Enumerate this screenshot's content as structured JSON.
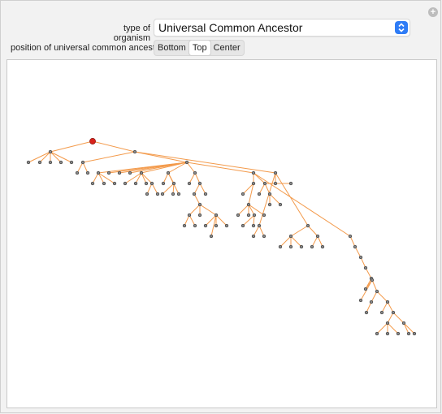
{
  "controls": {
    "organism_label": "type of organism",
    "organism_value": "Universal Common Ancestor",
    "position_label": "position of universal common ancestor",
    "position_options": [
      "Bottom",
      "Top",
      "Center"
    ],
    "position_selected": "Top"
  },
  "colors": {
    "edge": "#f39a4b",
    "node_fill": "#8a8a8a",
    "node_stroke": "#3a3a3a",
    "root_fill": "#d8221b",
    "root_stroke": "#8a1410",
    "accent": "#2f7cf6"
  },
  "icons": {
    "expand": "plus-circle-icon",
    "dropdown": "chevron-updown-icon"
  },
  "tree": {
    "root": "root",
    "edges": [
      [
        "root",
        "a1"
      ],
      [
        "root",
        "a2"
      ],
      [
        "a1",
        "b1"
      ],
      [
        "a1",
        "b2"
      ],
      [
        "a1",
        "b3"
      ],
      [
        "a1",
        "b4"
      ],
      [
        "a1",
        "b5"
      ],
      [
        "a2",
        "c1"
      ],
      [
        "a2",
        "c2"
      ],
      [
        "a2",
        "c3"
      ],
      [
        "c1",
        "d1"
      ],
      [
        "c1",
        "d2"
      ],
      [
        "c2",
        "e1"
      ],
      [
        "c2",
        "e2"
      ],
      [
        "c2",
        "e3"
      ],
      [
        "c2",
        "e4"
      ],
      [
        "c2",
        "e5"
      ],
      [
        "c2",
        "e6"
      ],
      [
        "c2",
        "e7"
      ],
      [
        "c2",
        "e8"
      ],
      [
        "e1",
        "f1"
      ],
      [
        "e1",
        "f2"
      ],
      [
        "e1",
        "f3"
      ],
      [
        "e2",
        "g1"
      ],
      [
        "e2",
        "g2"
      ],
      [
        "e2",
        "g3"
      ],
      [
        "e2",
        "g4"
      ],
      [
        "g4",
        "h1"
      ],
      [
        "g4",
        "h2"
      ],
      [
        "e3",
        "i1"
      ],
      [
        "e3",
        "i2"
      ],
      [
        "e3",
        "i3"
      ],
      [
        "i1",
        "j1"
      ],
      [
        "i1",
        "j2"
      ],
      [
        "e4",
        "k1"
      ],
      [
        "e4",
        "k2"
      ],
      [
        "k2",
        "l1"
      ],
      [
        "k2",
        "l2"
      ],
      [
        "l1",
        "m1"
      ],
      [
        "m1",
        "n1"
      ],
      [
        "m1",
        "n2"
      ],
      [
        "m1",
        "n3"
      ],
      [
        "n1",
        "o1"
      ],
      [
        "n1",
        "o2"
      ],
      [
        "n3",
        "p1"
      ],
      [
        "n3",
        "p2"
      ],
      [
        "n3",
        "p3"
      ],
      [
        "n3",
        "p4"
      ],
      [
        "c3",
        "q1"
      ],
      [
        "c3",
        "q2"
      ],
      [
        "c3",
        "q3"
      ],
      [
        "q1",
        "r1"
      ],
      [
        "q1",
        "r2"
      ],
      [
        "r1",
        "s1"
      ],
      [
        "r1",
        "s2"
      ],
      [
        "r1",
        "s3"
      ],
      [
        "r2",
        "t1"
      ],
      [
        "r2",
        "t2"
      ],
      [
        "q2",
        "u1"
      ],
      [
        "q2",
        "u2"
      ],
      [
        "e5",
        "w1"
      ],
      [
        "e5",
        "w2"
      ],
      [
        "e5",
        "w3"
      ],
      [
        "w2",
        "x1"
      ],
      [
        "w2",
        "x2"
      ],
      [
        "w2",
        "x3"
      ],
      [
        "w1",
        "y1"
      ],
      [
        "w1",
        "y2"
      ],
      [
        "y2",
        "z1"
      ],
      [
        "y2",
        "z2"
      ],
      [
        "y2",
        "z3"
      ],
      [
        "y2",
        "z4"
      ],
      [
        "z3",
        "aa1"
      ],
      [
        "z3",
        "aa2"
      ],
      [
        "x2",
        "ab1"
      ],
      [
        "x2",
        "ab2"
      ],
      [
        "w3",
        "ac1"
      ],
      [
        "ac1",
        "ad1"
      ],
      [
        "ad1",
        "ae1"
      ],
      [
        "ae1",
        "af1"
      ],
      [
        "af1",
        "ag1"
      ],
      [
        "ag1",
        "ah1"
      ],
      [
        "ah1",
        "ai1"
      ],
      [
        "ah1",
        "ai2"
      ],
      [
        "ai2",
        "aj1"
      ],
      [
        "ai2",
        "aj2"
      ],
      [
        "aj1",
        "ak1"
      ],
      [
        "aj2",
        "ak2"
      ],
      [
        "aj2",
        "ak3"
      ],
      [
        "ak3",
        "al1"
      ],
      [
        "ak3",
        "al2"
      ],
      [
        "al1",
        "am1"
      ],
      [
        "al1",
        "am2"
      ],
      [
        "al1",
        "am3"
      ],
      [
        "al2",
        "an1"
      ],
      [
        "al2",
        "an2"
      ]
    ]
  }
}
